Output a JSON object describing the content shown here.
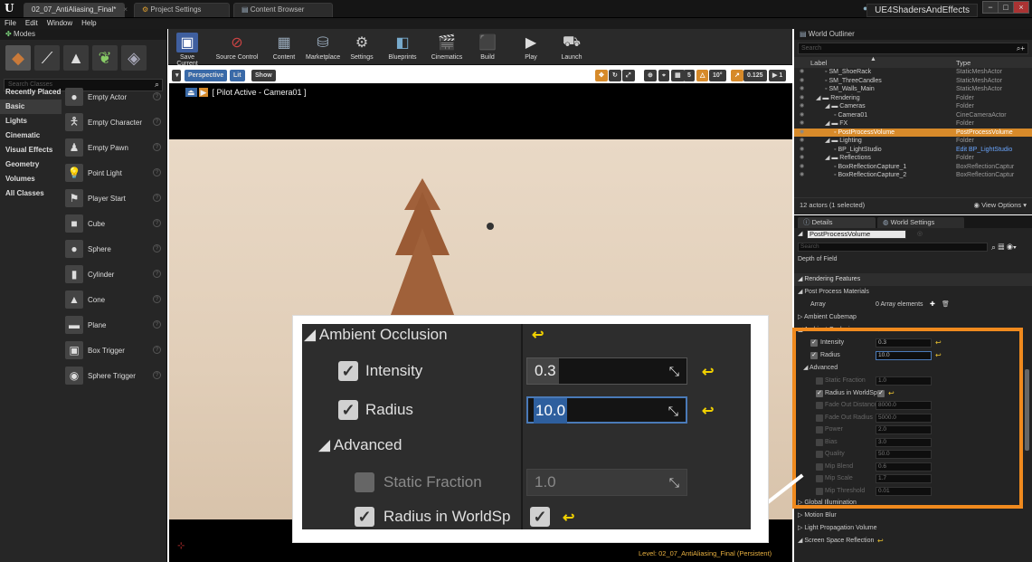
{
  "window": {
    "tabs": [
      "02_07_AntiAliasing_Final*",
      "Project Settings",
      "Content Browser"
    ],
    "project_name": "UE4ShadersAndEffects",
    "menu": [
      "File",
      "Edit",
      "Window",
      "Help"
    ]
  },
  "modes": {
    "title": "Modes",
    "search_placeholder": "Search Classes",
    "categories": [
      "Recently Placed",
      "Basic",
      "Lights",
      "Cinematic",
      "Visual Effects",
      "Geometry",
      "Volumes",
      "All Classes"
    ],
    "items": [
      "Empty Actor",
      "Empty Character",
      "Empty Pawn",
      "Point Light",
      "Player Start",
      "Cube",
      "Sphere",
      "Cylinder",
      "Cone",
      "Plane",
      "Box Trigger",
      "Sphere Trigger"
    ]
  },
  "toolbar": {
    "buttons": [
      "Save Current",
      "Source Control",
      "Content",
      "Marketplace",
      "Settings",
      "Blueprints",
      "Cinematics",
      "Build",
      "Play",
      "Launch"
    ]
  },
  "viewport": {
    "perspective": "Perspective",
    "lit": "Lit",
    "show": "Show",
    "pilot": "[ Pilot Active - Camera01 ]",
    "angle": "10°",
    "cam_speed": "0.125",
    "speed_num": "1",
    "level": "Level: 02_07_AntiAliasing_Final (Persistent)"
  },
  "outliner": {
    "title": "World Outliner",
    "search_placeholder": "Search",
    "col_label": "Label",
    "col_type": "Type",
    "rows": [
      {
        "label": "SM_ShoeRack",
        "type": "StaticMeshActor",
        "indent": 2
      },
      {
        "label": "SM_ThreeCandles",
        "type": "StaticMeshActor",
        "indent": 2
      },
      {
        "label": "SM_Walls_Main",
        "type": "StaticMeshActor",
        "indent": 2
      },
      {
        "label": "Rendering",
        "type": "Folder",
        "indent": 1
      },
      {
        "label": "Cameras",
        "type": "Folder",
        "indent": 2
      },
      {
        "label": "Camera01",
        "type": "CineCameraActor",
        "indent": 3
      },
      {
        "label": "FX",
        "type": "Folder",
        "indent": 2
      },
      {
        "label": "PostProcessVolume",
        "type": "PostProcessVolume",
        "indent": 3
      },
      {
        "label": "Lighting",
        "type": "Folder",
        "indent": 2
      },
      {
        "label": "BP_LightStudio",
        "type": "Edit BP_LightStudio",
        "indent": 3
      },
      {
        "label": "Reflections",
        "type": "Folder",
        "indent": 2
      },
      {
        "label": "BoxReflectionCapture_1",
        "type": "BoxReflectionCaptur",
        "indent": 3
      },
      {
        "label": "BoxReflectionCapture_2",
        "type": "BoxReflectionCaptur",
        "indent": 3
      }
    ],
    "selected_row": "PostProcessVolume",
    "status": "12 actors (1 selected)",
    "view_options": "View Options"
  },
  "details": {
    "tab_details": "Details",
    "tab_world": "World Settings",
    "object_name": "PostProcessVolume",
    "search_placeholder": "Search",
    "depth_of_field": "Depth of Field",
    "rendering_features": "Rendering Features",
    "post_process_materials": "Post Process Materials",
    "array_label": "Array",
    "array_value": "0 Array elements",
    "ambient_cubemap": "Ambient Cubemap",
    "ambient_occlusion": "Ambient Occlusion",
    "intensity_label": "Intensity",
    "intensity_value": "0.3",
    "radius_label": "Radius",
    "radius_value": "10.0",
    "advanced": "Advanced",
    "adv_rows": [
      {
        "label": "Static Fraction",
        "value": "1.0",
        "checked": false
      },
      {
        "label": "Radius in WorldSp",
        "value": "",
        "checked": true
      },
      {
        "label": "Fade Out Distance",
        "value": "8000.0",
        "checked": false
      },
      {
        "label": "Fade Out Radius",
        "value": "5000.0",
        "checked": false
      },
      {
        "label": "Power",
        "value": "2.0",
        "checked": false
      },
      {
        "label": "Bias",
        "value": "3.0",
        "checked": false
      },
      {
        "label": "Quality",
        "value": "50.0",
        "checked": false
      },
      {
        "label": "Mip Blend",
        "value": "0.6",
        "checked": false
      },
      {
        "label": "Mip Scale",
        "value": "1.7",
        "checked": false
      },
      {
        "label": "Mip Threshold",
        "value": "0.01",
        "checked": false
      }
    ],
    "global_illumination": "Global Illumination",
    "motion_blur": "Motion Blur",
    "light_propagation": "Light Propagation Volume",
    "ssr": "Screen Space Reflection"
  },
  "zoom": {
    "ambient_occlusion": "Ambient Occlusion",
    "intensity_label": "Intensity",
    "intensity_value": "0.3",
    "intensity_fill": 0.2,
    "radius_label": "Radius",
    "radius_value": "10.0",
    "advanced": "Advanced",
    "static_fraction_label": "Static Fraction",
    "static_fraction_value": "1.0",
    "radius_world_label": "Radius in WorldSp"
  },
  "colors": {
    "accent_orange": "#f08a1e",
    "selection": "#d78a2a",
    "reset_yellow": "#f0d000"
  }
}
